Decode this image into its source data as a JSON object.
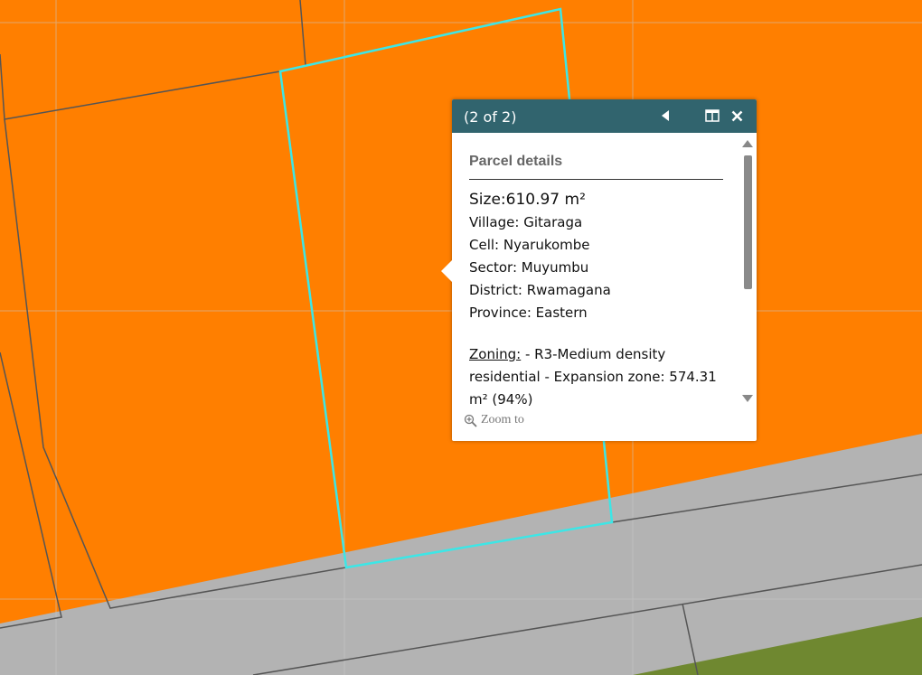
{
  "map": {
    "colors": {
      "parcel_fill": "#ff7f00",
      "road_fill": "#b3b3b3",
      "green_fill": "#6f8830",
      "parcel_outline": "#555555",
      "selected_outline": "#3de6e6",
      "grid_line": "#c9c9c9"
    }
  },
  "popup": {
    "title": "(2 of 2)",
    "content_title": "Parcel details",
    "size_label": "Size:",
    "size_value": "610.97 m²",
    "fields": [
      {
        "label": "Village:",
        "value": "Gitaraga"
      },
      {
        "label": "Cell:",
        "value": "Nyarukombe"
      },
      {
        "label": "Sector:",
        "value": "Muyumbu"
      },
      {
        "label": "District:",
        "value": "Rwamagana"
      },
      {
        "label": "Province:",
        "value": "Eastern"
      }
    ],
    "zoning_label": "Zoning:",
    "zoning_text": " - R3-Medium density residential - Expansion zone: 574.31 m² (94%)",
    "zoom_label": "Zoom to",
    "icons": {
      "prev": "triangle-left-icon",
      "maximize": "window-maximize-icon",
      "close": "close-icon",
      "zoom": "zoom-in-icon"
    }
  }
}
